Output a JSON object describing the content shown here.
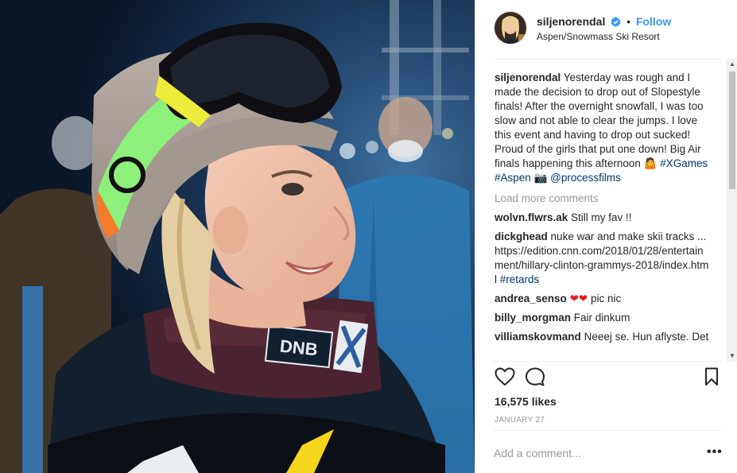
{
  "post": {
    "username": "siljenorendal",
    "dot": "•",
    "follow_label": "Follow",
    "location": "Aspen/Snowmass Ski Resort",
    "photo_sponsor_text": "DNB"
  },
  "caption": {
    "username": "siljenorendal",
    "text": "Yesterday was rough and I made the decision to drop out of Slopestyle finals! After the overnight snowfall, I was too slow and not able to clear the jumps. I love this event and having to drop out sucked! Proud of the girls that put one down! Big Air finals happening this afternoon",
    "emoji": "🤷",
    "tag_xgames": "#XGames",
    "tag_aspen": "#Aspen",
    "camera_emoji": "📷",
    "mention": "@processfilms"
  },
  "load_more_label": "Load more comments",
  "comments": [
    {
      "username": "wolvn.flwrs.ak",
      "text": "Still my fav !!"
    },
    {
      "username": "dickghead",
      "text": "nuke war and make skii tracks ... https://edition.cnn.com/2018/01/28/entertainment/hillary-clinton-grammys-2018/index.html",
      "tag": "#retards"
    },
    {
      "username": "andrea_senso",
      "text": "pic nic",
      "emoji": "❤❤"
    },
    {
      "username": "billy_morgman",
      "text": "Fair dinkum"
    },
    {
      "username": "villiamskovmand",
      "text": "Neeej se. Hun aflyste. Det"
    }
  ],
  "likes_label": "16,575 likes",
  "date_label": "JANUARY 27",
  "add_comment_placeholder": "Add a comment...",
  "more_options_label": "•••",
  "icons": {
    "like": "heart-icon",
    "comment": "comment-bubble-icon",
    "save": "bookmark-icon",
    "verified": "verified-badge-icon",
    "scroll_up": "scroll-up-arrow-icon",
    "scroll_down": "scroll-down-arrow-icon"
  },
  "colors": {
    "link_blue": "#3897f0",
    "tag_blue": "#003569",
    "muted_gray": "#999999",
    "heart_red": "#ed1c24"
  }
}
